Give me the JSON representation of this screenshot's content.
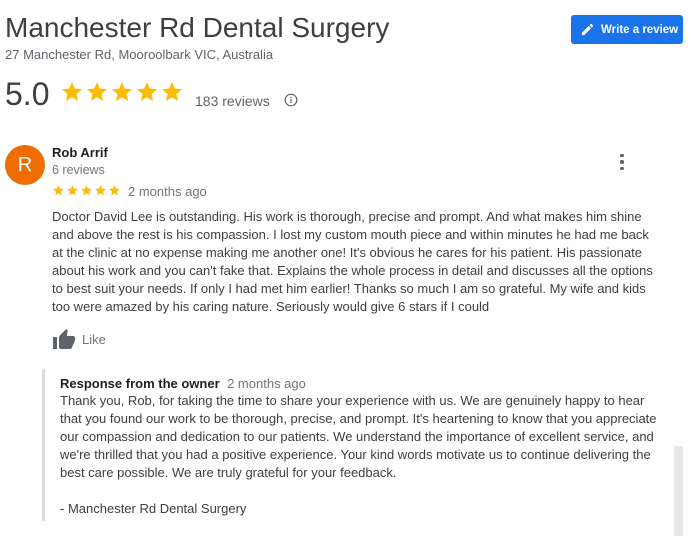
{
  "business": {
    "name": "Manchester Rd Dental Surgery",
    "address": "27 Manchester Rd, Mooroolbark VIC, Australia",
    "write_review_label": "Write a review"
  },
  "summary": {
    "rating": "5.0",
    "stars": 5,
    "reviews_label": "183 reviews"
  },
  "review": {
    "avatar_letter": "R",
    "avatar_color": "#ef6c00",
    "name": "Rob Arrif",
    "reviewer_reviews": "6 reviews",
    "stars": 5,
    "time": "2 months ago",
    "text": "Doctor David Lee is outstanding. His work is thorough, precise and prompt. And what makes him shine and above the rest is his compassion. I lost my custom mouth piece and within minutes he had me back at the clinic at no expense making me another one! It's obvious he cares for his patient. His passionate about his work and you can't fake that. Explains the whole process in detail and discusses all the options to best suit your needs. If only I had met him earlier! Thanks so much I am so grateful. My wife and kids too were amazed by his caring nature. Seriously would give 6 stars if I could",
    "like_label": "Like"
  },
  "owner_response": {
    "label": "Response from the owner",
    "time": "2 months ago",
    "text": "Thank you, Rob, for taking the time to share your experience with us. We are genuinely happy to hear that you found our work to be thorough, precise, and prompt. It's heartening to know that you appreciate our compassion and dedication to our patients. We understand the importance of excellent service, and we're thrilled that you had a positive experience. Your kind words motivate us to continue delivering the best care possible. We are truly grateful for your feedback.",
    "signature": "- Manchester Rd Dental Surgery"
  },
  "colors": {
    "accent": "#1a73e8",
    "star": "#fbbc04"
  }
}
